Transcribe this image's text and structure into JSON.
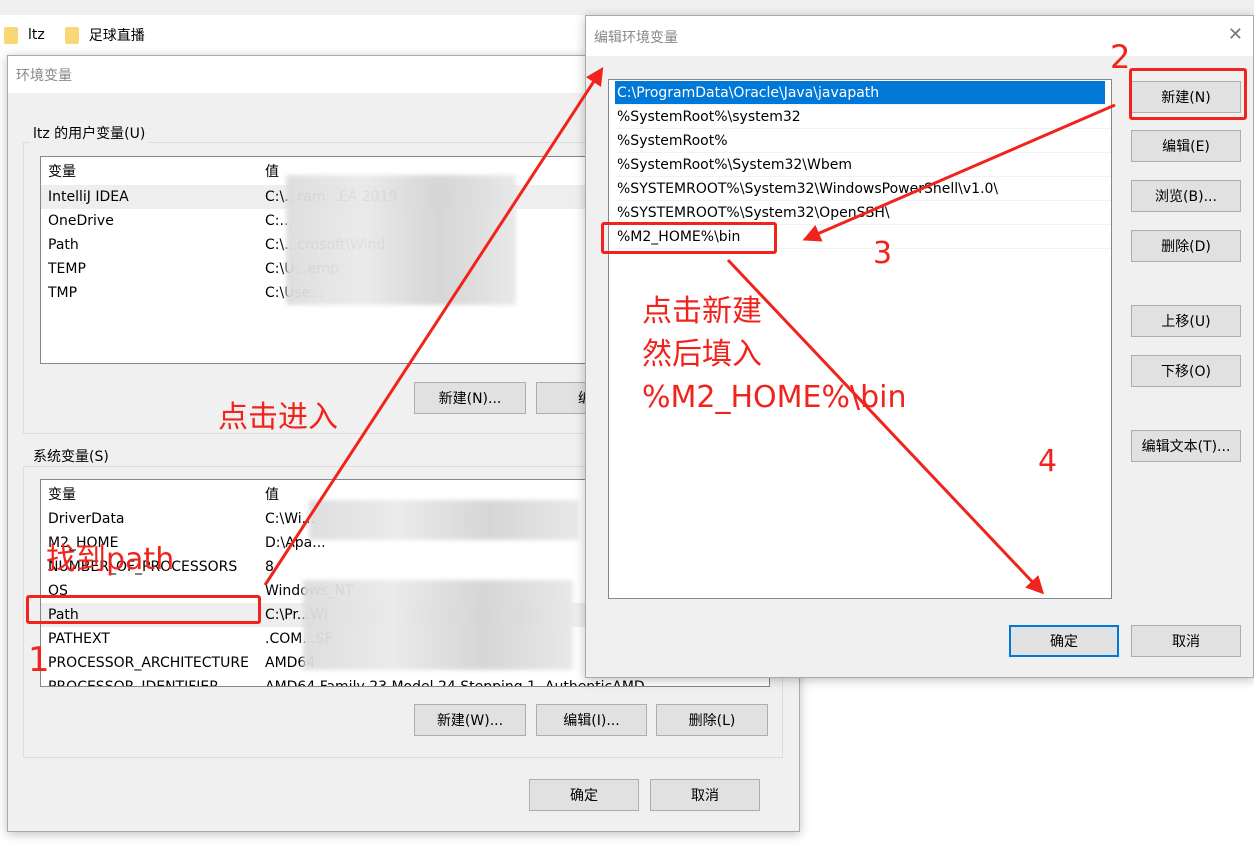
{
  "explorer": {
    "folders": [
      "ltz",
      "足球直播"
    ]
  },
  "env_dialog": {
    "title": "环境变量",
    "user_group_label": "ltz 的用户变量(U)",
    "columns": [
      "变量",
      "值"
    ],
    "user_vars": [
      {
        "name": "IntelliJ IDEA",
        "value": "C:\\...ram...EA 2019"
      },
      {
        "name": "OneDrive",
        "value": "C:..."
      },
      {
        "name": "Path",
        "value": "C:\\...crosoft\\Wind"
      },
      {
        "name": "TEMP",
        "value": "C:\\U...emp"
      },
      {
        "name": "TMP",
        "value": "C:\\Use..."
      }
    ],
    "user_buttons": {
      "new": "新建(N)...",
      "edit": "编辑"
    },
    "system_group_label": "系统变量(S)",
    "system_vars": [
      {
        "name": "DriverData",
        "value": "C:\\Wi..."
      },
      {
        "name": "M2_HOME",
        "value": "D:\\Apa..."
      },
      {
        "name": "NUMBER_OF_PROCESSORS",
        "value": "8"
      },
      {
        "name": "OS",
        "value": "Windows_NT"
      },
      {
        "name": "Path",
        "value": "C:\\Pr...Wi"
      },
      {
        "name": "PATHEXT",
        "value": ".COM...SF"
      },
      {
        "name": "PROCESSOR_ARCHITECTURE",
        "value": "AMD64"
      },
      {
        "name": "PROCESSOR_IDENTIFIER",
        "value": "AMD64 Family 23 Model 24 Stepping 1, AuthenticAMD"
      }
    ],
    "system_buttons": {
      "new": "新建(W)...",
      "edit": "编辑(I)...",
      "delete": "删除(L)"
    },
    "ok": "确定",
    "cancel": "取消"
  },
  "edit_dialog": {
    "title": "编辑环境变量",
    "close": "✕",
    "paths": [
      "C:\\ProgramData\\Oracle\\Java\\javapath",
      "%SystemRoot%\\system32",
      "%SystemRoot%",
      "%SystemRoot%\\System32\\Wbem",
      "%SYSTEMROOT%\\System32\\WindowsPowerShell\\v1.0\\",
      "%SYSTEMROOT%\\System32\\OpenSSH\\",
      "%M2_HOME%\\bin"
    ],
    "selected_index": 0,
    "buttons": {
      "new": "新建(N)",
      "edit": "编辑(E)",
      "browse": "浏览(B)...",
      "delete": "删除(D)",
      "up": "上移(U)",
      "down": "下移(O)",
      "edit_text": "编辑文本(T)..."
    },
    "ok": "确定",
    "cancel": "取消"
  },
  "annotations": {
    "step1": "1",
    "step1_text": "找到path",
    "click_enter": "点击进入",
    "step2": "2",
    "step3": "3",
    "step4": "4",
    "instruction": [
      "点击新建",
      "然后填入",
      "%M2_HOME%\\bin"
    ],
    "color": "#f0241c"
  }
}
